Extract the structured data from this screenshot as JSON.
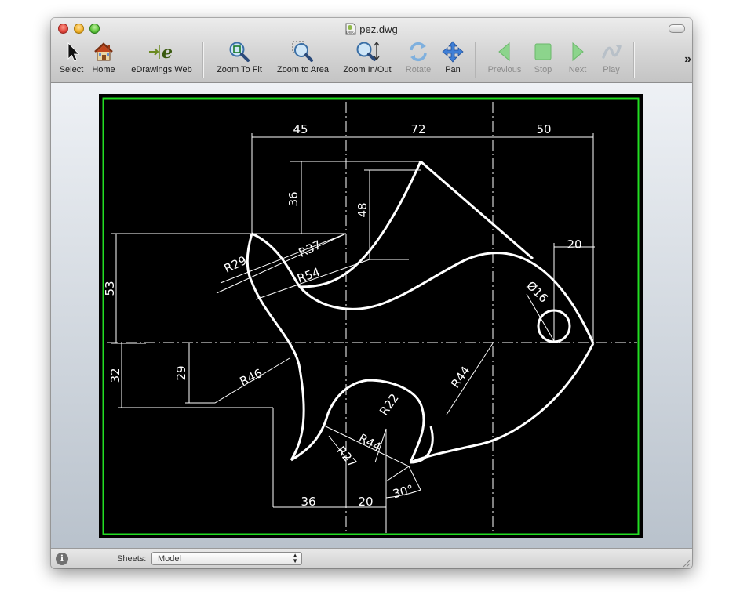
{
  "window": {
    "title": "pez.dwg",
    "file_badge": "DWG"
  },
  "toolbar": {
    "items": [
      {
        "label": "Select",
        "icon": "arrow-cursor-icon",
        "enabled": true
      },
      {
        "label": "Home",
        "icon": "home-icon",
        "enabled": true
      },
      {
        "label": "eDrawings Web",
        "icon": "edrawings-web-icon",
        "enabled": true
      },
      {
        "label": "Zoom To Fit",
        "icon": "zoom-to-fit-icon",
        "enabled": true
      },
      {
        "label": "Zoom to Area",
        "icon": "zoom-to-area-icon",
        "enabled": true
      },
      {
        "label": "Zoom In/Out",
        "icon": "zoom-in-out-icon",
        "enabled": true
      },
      {
        "label": "Rotate",
        "icon": "rotate-icon",
        "enabled": false
      },
      {
        "label": "Pan",
        "icon": "pan-icon",
        "enabled": true
      },
      {
        "label": "Previous",
        "icon": "previous-icon",
        "enabled": false
      },
      {
        "label": "Stop",
        "icon": "stop-icon",
        "enabled": false
      },
      {
        "label": "Next",
        "icon": "next-icon",
        "enabled": false
      },
      {
        "label": "Play",
        "icon": "play-icon",
        "enabled": false
      }
    ],
    "overflow": "»"
  },
  "drawing": {
    "dimensions": {
      "d45": "45",
      "d72": "72",
      "d50": "50",
      "d36_top": "36",
      "d48": "48",
      "d53": "53",
      "d20_right": "20",
      "r29": "R29",
      "r37": "R37",
      "r54": "R54",
      "dia16": "Ø16",
      "d32": "32",
      "d29": "29",
      "r46": "R46",
      "r44_right": "R44",
      "r22": "R22",
      "r44_lower": "R44",
      "r27": "R27",
      "d36_bottom": "36",
      "d20_bottom": "20",
      "ang30": "30°"
    },
    "colors": {
      "background": "#000000",
      "border": "#22dd22",
      "lines": "#ffffff"
    }
  },
  "statusbar": {
    "info_icon": "i",
    "sheets_label": "Sheets:",
    "sheets_value": "Model"
  }
}
